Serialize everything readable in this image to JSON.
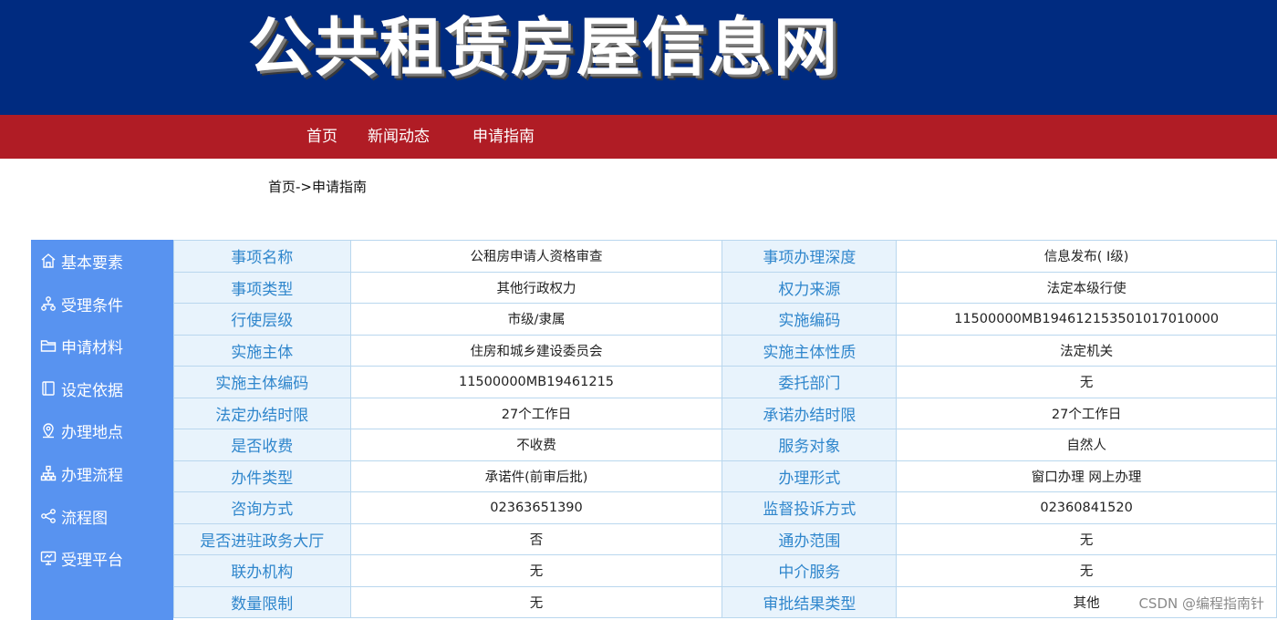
{
  "banner": {
    "title": "公共租赁房屋信息网"
  },
  "nav": {
    "items": [
      "首页",
      "新闻动态",
      "申请指南"
    ]
  },
  "breadcrumb": {
    "text": "首页->申请指南"
  },
  "sidebar": {
    "items": [
      {
        "label": "基本要素",
        "icon": "home-icon"
      },
      {
        "label": "受理条件",
        "icon": "org-icon"
      },
      {
        "label": "申请材料",
        "icon": "folder-icon"
      },
      {
        "label": "设定依据",
        "icon": "book-icon"
      },
      {
        "label": "办理地点",
        "icon": "location-icon"
      },
      {
        "label": "办理流程",
        "icon": "hierarchy-icon"
      },
      {
        "label": "流程图",
        "icon": "share-icon"
      },
      {
        "label": "受理平台",
        "icon": "monitor-icon"
      }
    ]
  },
  "table": {
    "rows": [
      [
        "事项名称",
        "公租房申请人资格审查",
        "事项办理深度",
        "信息发布( Ⅰ级)"
      ],
      [
        "事项类型",
        "其他行政权力",
        "权力来源",
        "法定本级行使"
      ],
      [
        "行使层级",
        "市级/隶属",
        "实施编码",
        "11500000MB19461215350101701000​0"
      ],
      [
        "实施主体",
        "住房和城乡建设委员会",
        "实施主体性质",
        "法定机关"
      ],
      [
        "实施主体编码",
        "11500000MB19461215",
        "委托部门",
        "无"
      ],
      [
        "法定办结时限",
        "27个工作日",
        "承诺办结时限",
        "27个工作日"
      ],
      [
        "是否收费",
        "不收费",
        "服务对象",
        "自然人"
      ],
      [
        "办件类型",
        "承诺件(前审后批)",
        "办理形式",
        "窗口办理  网上办理"
      ],
      [
        "咨询方式",
        "02363651390",
        "监督投诉方式",
        "02360841520"
      ],
      [
        "是否进驻政务大厅",
        "否",
        "通办范围",
        "无"
      ],
      [
        "联办机构",
        "无",
        "中介服务",
        "无"
      ],
      [
        "数量限制",
        "无",
        "审批结果类型",
        "其他"
      ]
    ]
  },
  "watermark": "CSDN @编程指南针",
  "colors": {
    "banner": "#002b80",
    "navbar": "#b01c25",
    "sidebar": "#5893f0",
    "key_text": "#2f86cc",
    "key_bg": "#e8f3fc"
  }
}
